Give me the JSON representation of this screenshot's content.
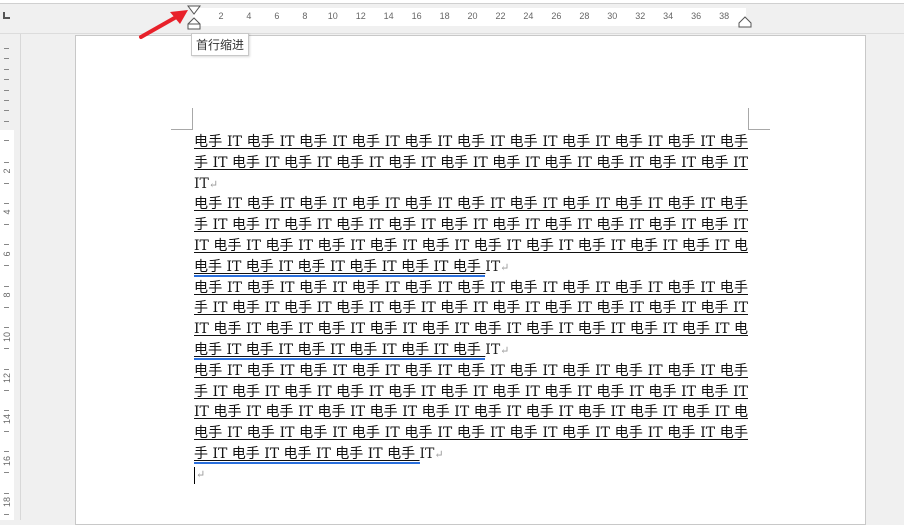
{
  "ruler": {
    "horizontal_ticks": [
      "2",
      "4",
      "6",
      "8",
      "10",
      "12",
      "14",
      "16",
      "18",
      "20",
      "22",
      "24",
      "26",
      "28",
      "30",
      "32",
      "34",
      "36",
      "38"
    ],
    "vertical_ticks": [
      "2",
      "4",
      "6",
      "8",
      "10",
      "12",
      "14",
      "16",
      "18"
    ]
  },
  "tooltip": "首行缩进",
  "colors": {
    "accent_underline": "#2a6fdc",
    "arrow": "#e8212a"
  },
  "document": {
    "lines": [
      {
        "u": "电手 IT 电手 IT 电手 IT 电手 IT 电手 IT 电手 IT 电手 IT 电手 IT 电手 IT 电手 IT 电手 IT 电",
        "tail": "",
        "pm": ""
      },
      {
        "u": "手 IT 电手 IT 电手 IT 电手 IT 电手 IT 电手 IT 电手 IT 电手 IT 电手 IT 电手 IT 电手 IT 电手",
        "tail": "",
        "pm": ""
      },
      {
        "u": "",
        "tail": "IT",
        "pm": "↵"
      },
      {
        "u": "电手 IT 电手 IT 电手 IT 电手 IT 电手 IT 电手 IT 电手 IT 电手 IT 电手 IT 电手 IT 电手 IT 电",
        "tail": "",
        "pm": ""
      },
      {
        "u": "手 IT 电手 IT 电手 IT 电手 IT 电手 IT 电手 IT 电手 IT 电手 IT 电手 IT 电手 IT 电手 IT 电手",
        "tail": "",
        "pm": ""
      },
      {
        "u": "IT 电手 IT 电手 IT 电手 IT 电手 IT 电手 IT 电手 IT 电手 IT 电手 IT 电手 IT 电手 IT 电手 IT",
        "tail": "",
        "pm": ""
      },
      {
        "u": "电手 IT 电手 IT 电手 IT 电手 IT 电手 IT 电手 ",
        "tail": "IT",
        "pm": "↵"
      },
      {
        "u": "电手 IT 电手 IT 电手 IT 电手 IT 电手 IT 电手 IT 电手 IT 电手 IT 电手 IT 电手 IT 电手 IT 电",
        "tail": "",
        "pm": ""
      },
      {
        "u": "手 IT 电手 IT 电手 IT 电手 IT 电手 IT 电手 IT 电手 IT 电手 IT 电手 IT 电手 IT 电手 IT 电手",
        "tail": "",
        "pm": ""
      },
      {
        "u": "IT 电手 IT 电手 IT 电手 IT 电手 IT 电手 IT 电手 IT 电手 IT 电手 IT 电手 IT 电手 IT 电手 IT",
        "tail": "",
        "pm": ""
      },
      {
        "u": "电手 IT 电手 IT 电手 IT 电手 IT 电手 IT 电手 ",
        "tail": "IT",
        "pm": "↵"
      },
      {
        "u": "电手 IT 电手 IT 电手 IT 电手 IT 电手 IT 电手 IT 电手 IT 电手 IT 电手 IT 电手 IT 电手 IT 电",
        "tail": "",
        "pm": ""
      },
      {
        "u": "手 IT 电手 IT 电手 IT 电手 IT 电手 IT 电手 IT 电手 IT 电手 IT 电手 IT 电手 IT 电手 IT 电手",
        "tail": "",
        "pm": ""
      },
      {
        "u": "IT 电手 IT 电手 IT 电手 IT 电手 IT 电手 IT 电手 IT 电手 IT 电手 IT 电手 IT 电手 IT 电手 IT",
        "tail": "",
        "pm": ""
      },
      {
        "u": "电手 IT 电手 IT 电手 IT 电手 IT 电手 IT 电手 IT 电手 IT 电手 IT 电手 IT 电手 IT 电手 IT 电",
        "tail": "",
        "pm": ""
      },
      {
        "u": "手 IT 电手 IT 电手 IT 电手 IT 电手 ",
        "tail": "IT",
        "pm": "↵"
      }
    ],
    "empty_paragraph_mark": "↵"
  }
}
